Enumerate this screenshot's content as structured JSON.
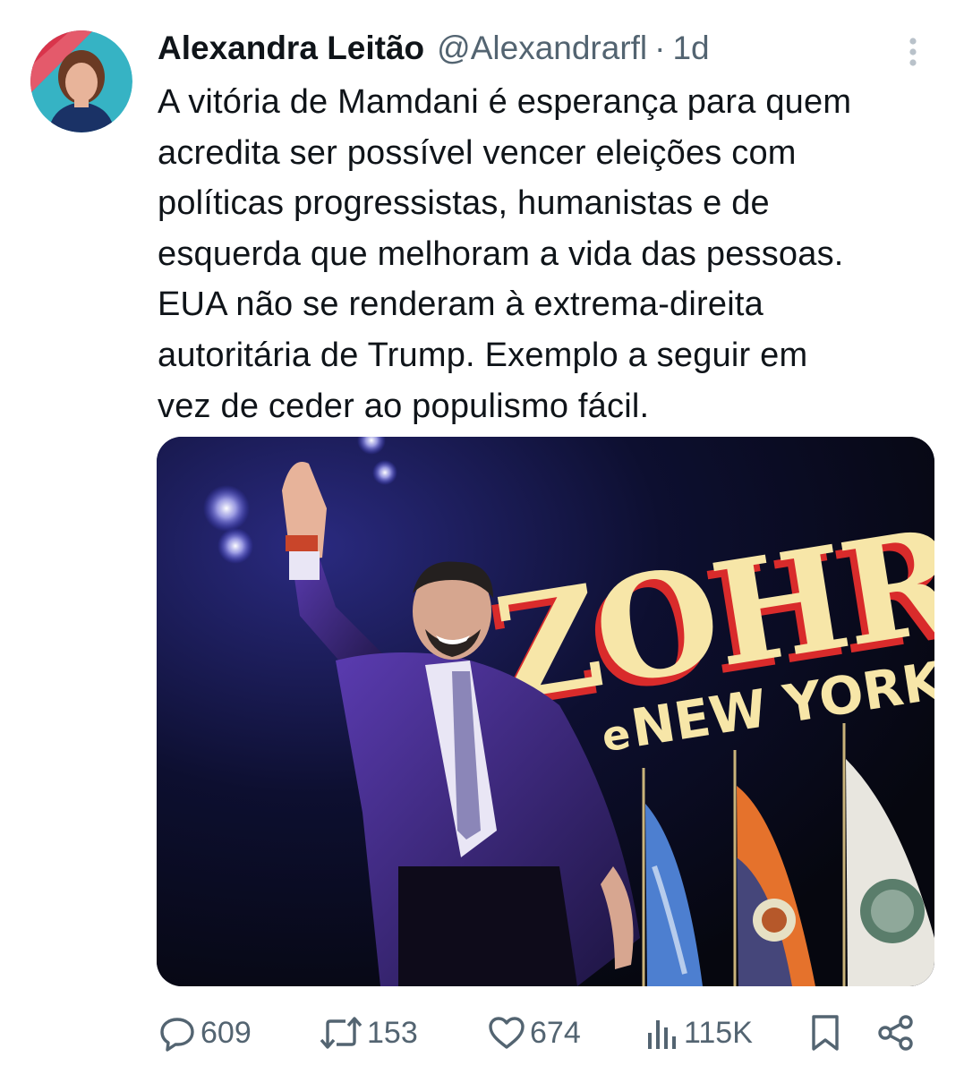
{
  "tweet": {
    "author_name": "Alexandra Leitão",
    "author_handle": "@Alexandrarfl",
    "separator": "·",
    "time": "1d",
    "text": "A vitória de Mamdani é esperança para quem\nacredita ser possível vencer eleições com\npolíticas progressistas, humanistas e de\nesquerda que melhoram a vida das pessoas.\nEUA não se renderam à extrema-direita\nautoritária de Trump. Exemplo a seguir em\nvez de ceder ao populismo fácil.",
    "image": {
      "sign_text_1": "ZOHRA",
      "sign_text_2": "NEW YORK",
      "sign_text_prefix": "e"
    }
  },
  "actions": {
    "replies": "609",
    "reposts": "153",
    "likes": "674",
    "views": "115K"
  },
  "colors": {
    "text": "#0f1419",
    "muted": "#536471",
    "avatar_ring_red": "#d9344b",
    "avatar_ring_teal": "#36b3c4"
  },
  "icons": [
    "more-vertical-icon",
    "reply-icon",
    "repost-icon",
    "like-icon",
    "views-icon",
    "bookmark-icon",
    "share-icon"
  ]
}
